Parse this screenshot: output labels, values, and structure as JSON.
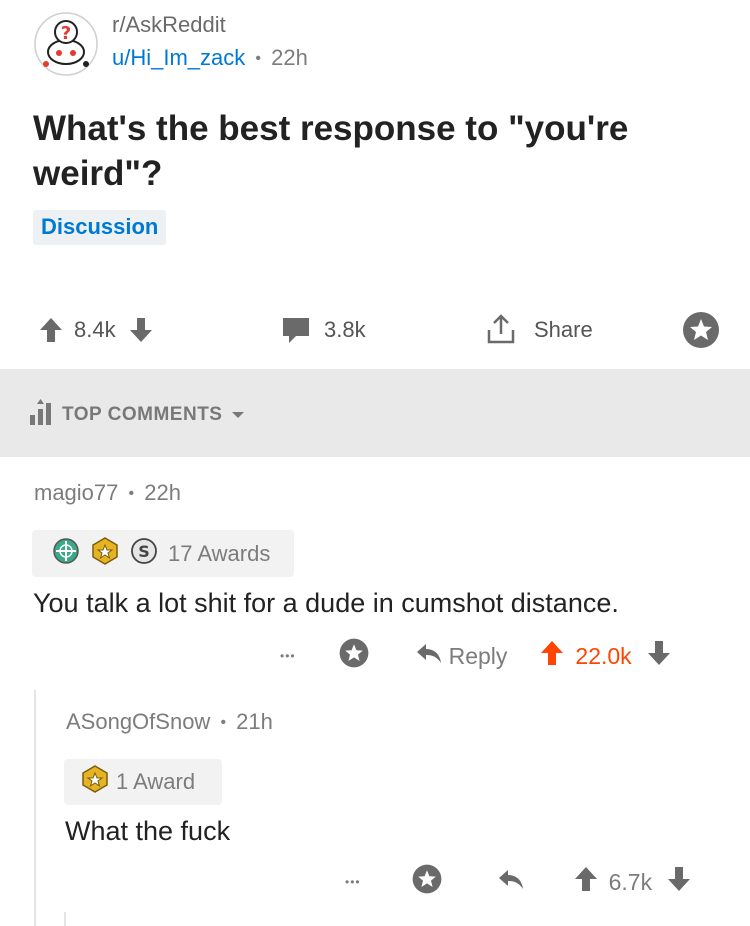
{
  "post": {
    "subreddit": "r/AskReddit",
    "author": "u/Hi_Im_zack",
    "separator": "•",
    "age": "22h",
    "title": "What's the best response to \"you're weird\"?",
    "flair": "Discussion",
    "score": "8.4k",
    "comments": "3.8k",
    "share_label": "Share"
  },
  "sort": {
    "label": "TOP COMMENTS"
  },
  "comments": [
    {
      "author": "magio77",
      "age": "22h",
      "awards_label": "17 Awards",
      "body": "You talk a lot shit for a dude in cumshot distance.",
      "more": "•••",
      "reply_label": "Reply",
      "score": "22.0k",
      "score_color": "#ff4500"
    },
    {
      "author": "ASongOfSnow",
      "age": "21h",
      "awards_label": "1 Award",
      "body": "What the fuck",
      "more": "•••",
      "score": "6.7k"
    }
  ],
  "colors": {
    "link_blue": "#0079d3",
    "upvote_orange": "#ff4500",
    "muted_gray": "#7c7c7c",
    "bar_gray": "#e9e9e9"
  },
  "icons": [
    "askreddit-avatar-icon",
    "upvote-icon",
    "downvote-icon",
    "comment-icon",
    "share-icon",
    "save-star-icon",
    "top-comments-icon",
    "chevron-down-icon",
    "award-globe-icon",
    "award-gold-icon",
    "award-silver-icon",
    "reply-arrow-icon",
    "more-dots-icon"
  ]
}
